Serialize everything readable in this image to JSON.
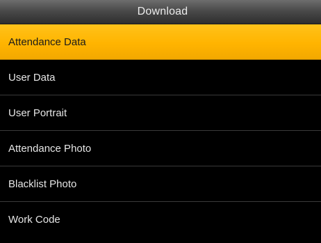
{
  "header": {
    "title": "Download"
  },
  "menu": {
    "items": [
      {
        "label": "Attendance Data"
      },
      {
        "label": "User Data"
      },
      {
        "label": "User Portrait"
      },
      {
        "label": "Attendance Photo"
      },
      {
        "label": "Blacklist Photo"
      },
      {
        "label": "Work Code"
      }
    ],
    "selected_index": 0
  },
  "colors": {
    "highlight": "#ffb400",
    "background": "#000000",
    "text": "#e6e6e6"
  }
}
